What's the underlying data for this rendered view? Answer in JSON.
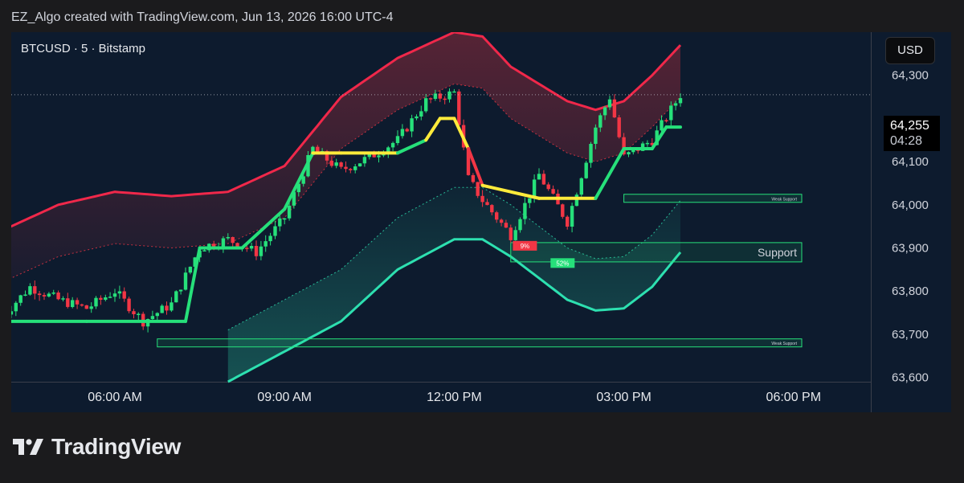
{
  "header": {
    "attribution": "EZ_Algo created with TradingView.com, Jun 13, 2026 16:00 UTC-4"
  },
  "symbol": {
    "label": "BTCUSD · 5 · Bitstamp"
  },
  "currency_button": {
    "label": "USD"
  },
  "price_badge": {
    "price": "64,255",
    "countdown": "04:28"
  },
  "brand": {
    "name": "TradingView"
  },
  "colors": {
    "background": "#0d1b2e",
    "bull": "#26e07a",
    "bear": "#f23645",
    "neutral_trend": "#ffeb3b",
    "upper_band": "#f0284a",
    "lower_band": "#2de0b0"
  },
  "chart_data": {
    "type": "candlestick",
    "title": "BTCUSD · 5 · Bitstamp",
    "y_axis": {
      "ticks": [
        64300,
        64100,
        64000,
        63900,
        63800,
        63700,
        63600
      ],
      "tick_labels": [
        "64,300",
        "64,100",
        "64,000",
        "63,900",
        "63,800",
        "63,700",
        "63,600"
      ],
      "ylim": [
        63590,
        64400
      ]
    },
    "x_axis": {
      "ticks": [
        "06:00",
        "09:00",
        "12:00",
        "15:00",
        "18:00"
      ],
      "tick_labels": [
        "06:00 AM",
        "09:00 AM",
        "12:00 PM",
        "03:00 PM",
        "06:00 PM"
      ]
    },
    "close_series": {
      "x": [
        "04:00",
        "04:30",
        "05:00",
        "05:30",
        "06:00",
        "06:30",
        "07:00",
        "07:30",
        "08:00",
        "08:30",
        "09:00",
        "09:30",
        "10:00",
        "10:30",
        "11:00",
        "11:30",
        "12:00",
        "12:15",
        "12:30",
        "13:00",
        "13:30",
        "14:00",
        "14:30",
        "14:45",
        "15:00",
        "15:30",
        "16:00"
      ],
      "y": [
        63740,
        63810,
        63780,
        63760,
        63800,
        63730,
        63770,
        63900,
        63920,
        63890,
        63970,
        64130,
        64080,
        64110,
        64150,
        64240,
        64260,
        64060,
        64010,
        63930,
        64070,
        63960,
        64180,
        64250,
        64110,
        64150,
        64255
      ]
    },
    "trend_line": {
      "x": [
        "04:00",
        "05:30",
        "07:15",
        "07:30",
        "08:15",
        "09:00",
        "09:30",
        "10:00",
        "11:00",
        "11:30",
        "11:45",
        "12:00",
        "12:15",
        "12:30",
        "13:30",
        "14:30",
        "15:00",
        "15:30",
        "15:45",
        "16:00"
      ],
      "y": [
        63730,
        63730,
        63730,
        63900,
        63900,
        63990,
        64120,
        64120,
        64120,
        64150,
        64200,
        64200,
        64130,
        64045,
        64015,
        64015,
        64130,
        64130,
        64180,
        64180
      ],
      "state": [
        "bull",
        "bull",
        "bull",
        "bull",
        "bull",
        "bull",
        "bull",
        "neutral",
        "neutral",
        "bull",
        "neutral",
        "neutral",
        "neutral",
        "bear",
        "neutral",
        "neutral",
        "bull",
        "bull",
        "bull",
        "bull"
      ]
    },
    "upper_band": {
      "x": [
        "04:00",
        "05:00",
        "06:00",
        "07:00",
        "08:00",
        "09:00",
        "09:30",
        "10:00",
        "11:00",
        "12:00",
        "12:30",
        "13:00",
        "14:00",
        "14:30",
        "15:00",
        "15:30",
        "16:00"
      ],
      "y": [
        63940,
        64000,
        64030,
        64020,
        64030,
        64090,
        64170,
        64250,
        64340,
        64400,
        64390,
        64320,
        64240,
        64220,
        64240,
        64300,
        64370
      ]
    },
    "lower_band": {
      "x": [
        "08:00",
        "09:00",
        "10:00",
        "11:00",
        "12:00",
        "12:30",
        "13:00",
        "13:30",
        "14:00",
        "14:30",
        "15:00",
        "15:30",
        "16:00"
      ],
      "y": [
        63590,
        63660,
        63730,
        63850,
        63920,
        63920,
        63880,
        63830,
        63780,
        63755,
        63760,
        63810,
        63890
      ]
    },
    "levels": [
      {
        "label": "Support",
        "price": 63890,
        "start": "13:00"
      },
      {
        "label": "Weak Support",
        "price": 64015,
        "start": "15:00"
      },
      {
        "label": "Weak Support",
        "price": 63680,
        "start": "06:45"
      }
    ],
    "annotations": [
      {
        "text": "9%",
        "time": "13:15",
        "price": 63905
      },
      {
        "text": "52%",
        "time": "13:55",
        "price": 63865
      }
    ],
    "last_price": 64255
  }
}
